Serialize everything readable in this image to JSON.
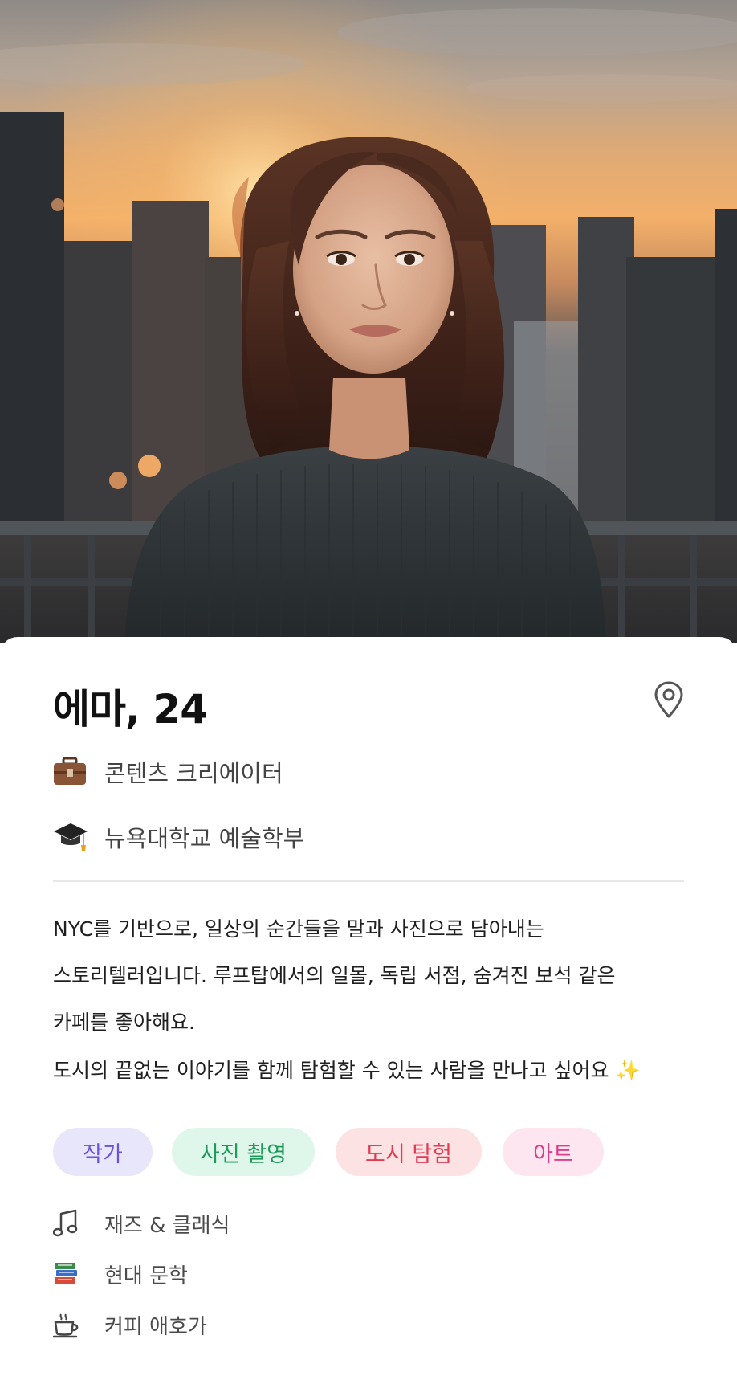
{
  "profile": {
    "name": "에마, 24",
    "job": "콘텐츠 크리에이터",
    "school": "뉴욕대학교 예술학부",
    "bio_line1": "NYC를 기반으로, 일상의 순간들을 말과 사진으로 담아내는",
    "bio_line2": "스토리텔러입니다. 루프탑에서의 일몰, 독립 서점, 숨겨진 보석 같은",
    "bio_line3": "카페를 좋아해요.",
    "bio_second": "도시의 끝없는 이야기를 함께 탐험할 수 있는 사람을 만나고 싶어요",
    "bio_second_emoji": "✨"
  },
  "tags": [
    {
      "label": "작가",
      "bg": "#e8e6fb",
      "color": "#6b52d9"
    },
    {
      "label": "사진 촬영",
      "bg": "#dff7ea",
      "color": "#1f9a5a"
    },
    {
      "label": "도시 탐험",
      "bg": "#fde2e4",
      "color": "#e03a54"
    },
    {
      "label": "아트",
      "bg": "#fde6f0",
      "color": "#de3d8a"
    }
  ],
  "interests": [
    {
      "icon": "music-note-icon",
      "label": "재즈 & 클래식"
    },
    {
      "icon": "books-icon",
      "label": "현대 문학"
    },
    {
      "icon": "coffee-cup-icon",
      "label": "커피 애호가"
    }
  ],
  "icons": {
    "location": "location-pin-icon",
    "job": "briefcase-icon",
    "school": "graduation-cap-icon"
  }
}
